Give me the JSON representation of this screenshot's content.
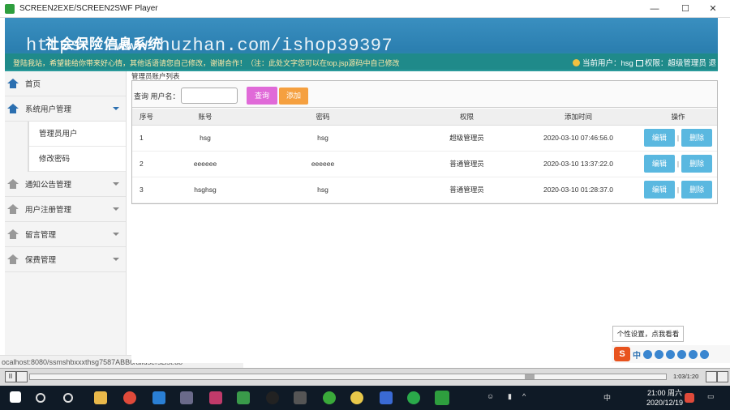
{
  "window": {
    "title": "SCREEN2EXE/SCREEN2SWF Player",
    "minimize": "—",
    "maximize": "☐",
    "close": "✕"
  },
  "header": {
    "system_title": "社会保险信息系统",
    "watermark": "https://www.huzhan.com/ishop39397",
    "marquee": "登陆我站，希望能给你带来好心情，其他话语请您自己修改，谢谢合作！（注：此处文字您可以在top.jsp源码中自己修改",
    "current_user_label": "当前用户：hsg",
    "permission_label": "权限：超级管理员",
    "logout_partial": "退"
  },
  "sidebar": {
    "items": [
      {
        "label": "首页"
      },
      {
        "label": "系统用户管理"
      },
      {
        "label": "通知公告管理"
      },
      {
        "label": "用户注册管理"
      },
      {
        "label": "留言管理"
      },
      {
        "label": "保费管理"
      }
    ],
    "submenu": [
      {
        "label": "管理员用户"
      },
      {
        "label": "修改密码"
      }
    ]
  },
  "status_url": "ocalhost:8080/ssmshbxxxthsg7587ABB6/allusersList.do",
  "content": {
    "breadcrumb": "管理员账户列表",
    "search_label": "查询 用户名：",
    "search_value": "",
    "query_button": "查询",
    "add_button": "添加",
    "table": {
      "headers": [
        "序号",
        "账号",
        "密码",
        "权限",
        "添加时间",
        "操作"
      ],
      "rows": [
        {
          "seq": "1",
          "account": "hsg",
          "password": "hsg",
          "role": "超级管理员",
          "time": "2020-03-10 07:46:56.0"
        },
        {
          "seq": "2",
          "account": "eeeeee",
          "password": "eeeeee",
          "role": "普通管理员",
          "time": "2020-03-10 13:37:22.0"
        },
        {
          "seq": "3",
          "account": "hsghsg",
          "password": "hsg",
          "role": "普通管理员",
          "time": "2020-03-10 01:28:37.0"
        }
      ],
      "edit_label": "编辑",
      "separator": "|",
      "delete_label": "删除"
    }
  },
  "ime": {
    "tooltip": "个性设置，点我看看",
    "logo": "S",
    "mode": "中"
  },
  "player": {
    "pause": "II",
    "time": "1:03/1:20"
  },
  "taskbar": {
    "ime_mode": "中",
    "time": "21:00 周六",
    "date": "2020/12/19"
  },
  "colors": {
    "header_blue": "#2b7fb0",
    "query_pink": "#e06ad8",
    "add_orange": "#f5a040",
    "op_blue": "#5ab8e0"
  }
}
